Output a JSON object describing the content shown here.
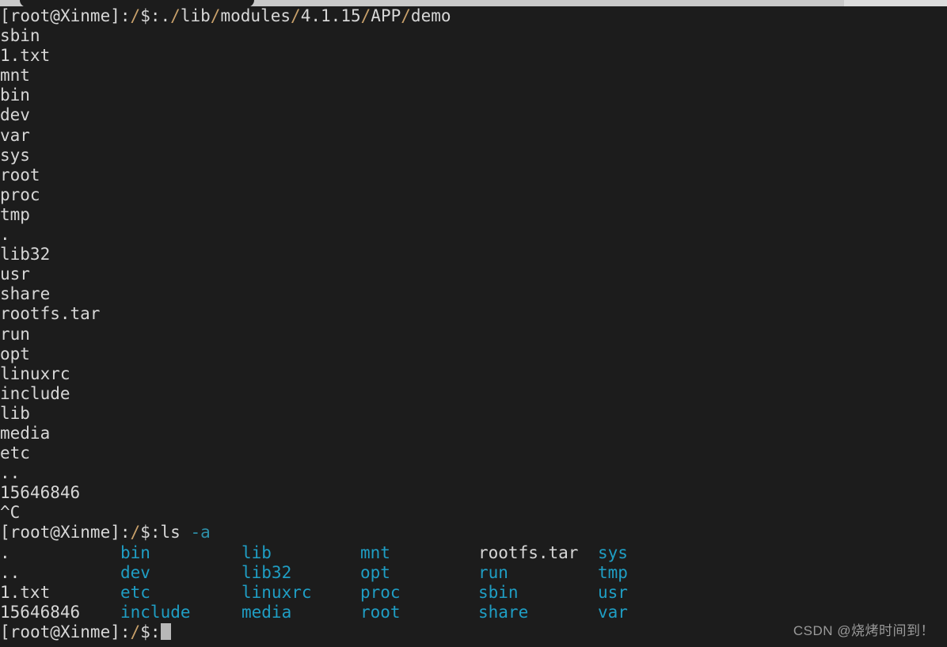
{
  "window": {
    "tab_title": "",
    "background_color": "#1c1c1c",
    "foreground_color": "#d7d7d7",
    "dir_color": "#1f9ec4",
    "path_color": "#c8a06a"
  },
  "session": {
    "prompt_user_host": "[root@Xinme]",
    "prompt_path": ":/$:",
    "first_command_echo": "[root@Xinme]:/$:./lib/modules/4.1.15/APP/demo",
    "command_prefix": "[root@Xinme]:/$:",
    "second_command": "ls",
    "second_command_flag": "-a",
    "interrupt": "^C"
  },
  "first_output": {
    "entries": [
      "sbin",
      "1.txt",
      "mnt",
      "bin",
      "dev",
      "var",
      "sys",
      "root",
      "proc",
      "tmp",
      ".",
      "lib32",
      "usr",
      "share",
      "rootfs.tar",
      "run",
      "opt",
      "linuxrc",
      "include",
      "lib",
      "media",
      "etc",
      "..",
      "15646846"
    ]
  },
  "ls_output": {
    "rows": [
      [
        {
          "name": ".",
          "kind": "other"
        },
        {
          "name": "bin",
          "kind": "dir"
        },
        {
          "name": "lib",
          "kind": "dir"
        },
        {
          "name": "mnt",
          "kind": "dir"
        },
        {
          "name": "rootfs.tar",
          "kind": "file"
        },
        {
          "name": "sys",
          "kind": "dir"
        }
      ],
      [
        {
          "name": "..",
          "kind": "other"
        },
        {
          "name": "dev",
          "kind": "dir"
        },
        {
          "name": "lib32",
          "kind": "dir"
        },
        {
          "name": "opt",
          "kind": "dir"
        },
        {
          "name": "run",
          "kind": "dir"
        },
        {
          "name": "tmp",
          "kind": "dir"
        }
      ],
      [
        {
          "name": "1.txt",
          "kind": "file"
        },
        {
          "name": "etc",
          "kind": "dir"
        },
        {
          "name": "linuxrc",
          "kind": "dir"
        },
        {
          "name": "proc",
          "kind": "dir"
        },
        {
          "name": "sbin",
          "kind": "dir"
        },
        {
          "name": "usr",
          "kind": "dir"
        }
      ],
      [
        {
          "name": "15646846",
          "kind": "file"
        },
        {
          "name": "include",
          "kind": "dir"
        },
        {
          "name": "media",
          "kind": "dir"
        },
        {
          "name": "root",
          "kind": "dir"
        },
        {
          "name": "share",
          "kind": "dir"
        },
        {
          "name": "var",
          "kind": "dir"
        }
      ]
    ]
  },
  "watermark": {
    "text": "CSDN @烧烤时间到！"
  }
}
